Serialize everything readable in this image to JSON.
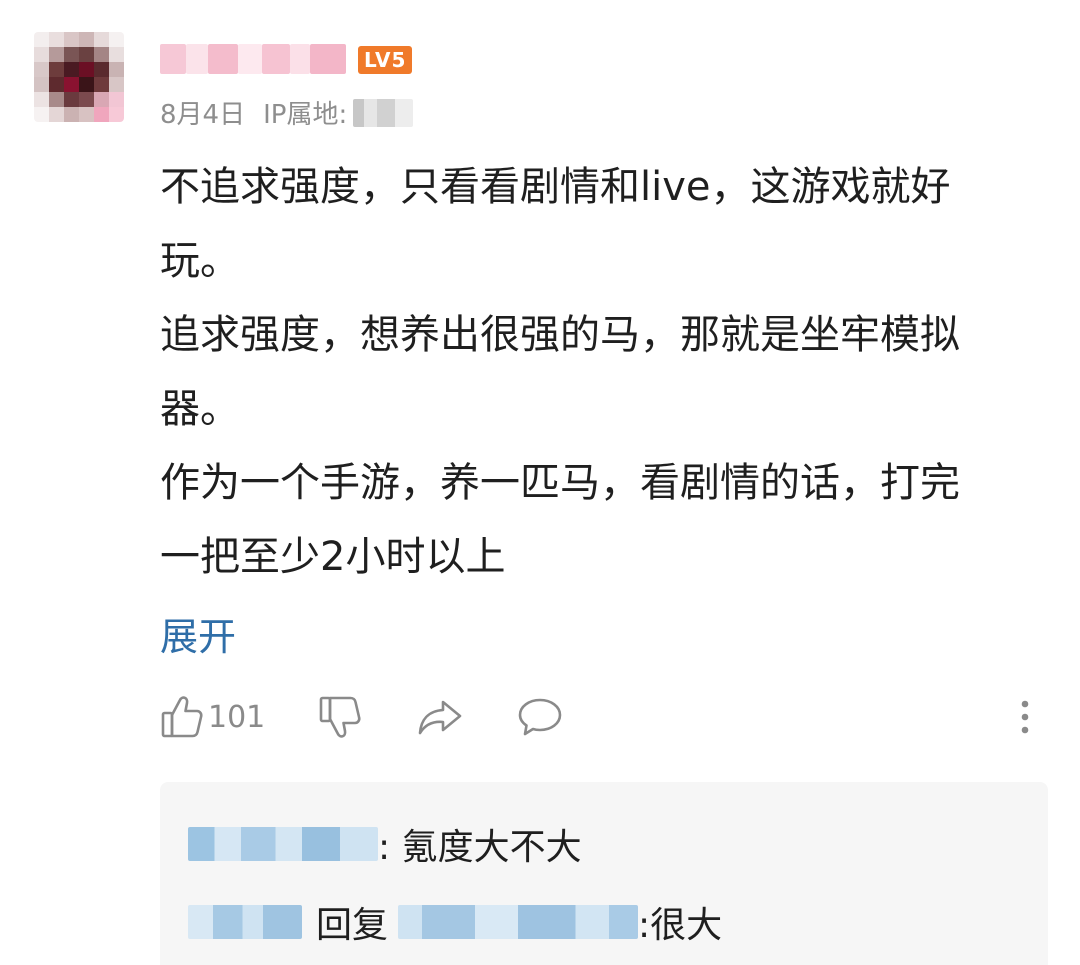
{
  "comment": {
    "level_badge": "LV5",
    "date": "8月4日",
    "ip_label": "IP属地:",
    "body_lines": [
      "不追求强度，只看看剧情和live，这游戏就好",
      "玩。",
      "追求强度，想养出很强的马，那就是坐牢模拟",
      "器。",
      "作为一个手游，养一匹马，看剧情的话，打完",
      "一把至少2小时以上"
    ],
    "expand_label": "展开",
    "like_count": "101",
    "icons": [
      "thumbs-up-icon",
      "thumbs-down-icon",
      "share-icon",
      "comment-icon",
      "more-icon"
    ]
  },
  "replies": [
    {
      "text": ": 氪度大不大"
    },
    {
      "reply_word": "回复",
      "text": " :很大"
    }
  ],
  "colors": {
    "badge": "#f07a2a",
    "link": "#2f6ea8",
    "meta": "#8e8e8e",
    "reply_bg": "#f6f6f6"
  }
}
